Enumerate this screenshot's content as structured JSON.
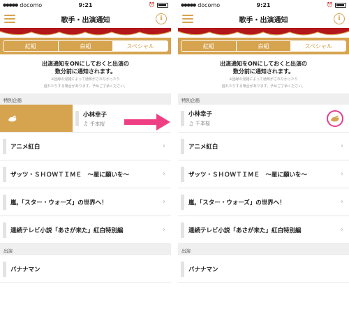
{
  "status": {
    "carrier": "docomo",
    "time": "9:21"
  },
  "nav": {
    "title": "歌手・出演通知",
    "menu_icon": "hamburger-menu-icon",
    "info_icon": "info-icon",
    "info_label": "i"
  },
  "tabs": [
    {
      "label": "紅組",
      "active": false
    },
    {
      "label": "白組",
      "active": false
    },
    {
      "label": "スペシャル",
      "active": true
    }
  ],
  "notice": {
    "main_line1": "出演通知をONにしておくと出演の",
    "main_line2": "数分前に通知されます。",
    "sub_line1": "※回線の混雑によって通知がされなかったり",
    "sub_line2": "遅れたりする場合があります。予めご了承ください。"
  },
  "sections": {
    "special_label": "特別企画",
    "performers_label": "出演"
  },
  "special_items": [
    {
      "type": "artist",
      "name": "小林幸子",
      "song": "千本桜"
    },
    {
      "type": "program",
      "title": "アニメ紅白"
    },
    {
      "type": "program",
      "title": "ザッツ・ＳＨＯＷＴＩＭＥ　〜星に願いを〜"
    },
    {
      "type": "program",
      "title": "嵐,「スター・ウォーズ」の世界へ！"
    },
    {
      "type": "program",
      "title": "連続テレビ小説「あさが来た」紅白特別編"
    }
  ],
  "performer_items": [
    {
      "title": "バナナマン"
    }
  ],
  "colors": {
    "accent": "#d6a34f",
    "highlight": "#e83e8c",
    "arrow": "#ef3f84"
  }
}
